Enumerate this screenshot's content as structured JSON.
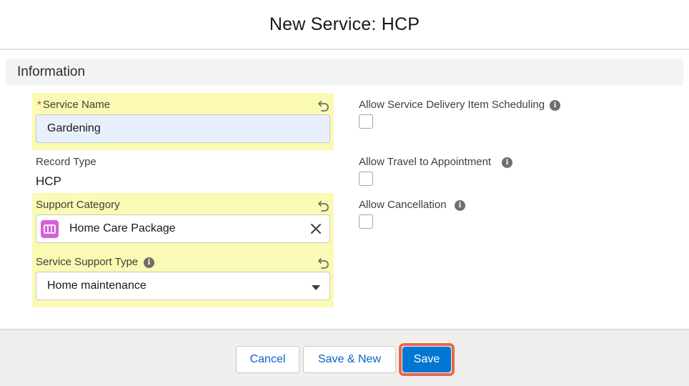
{
  "modal": {
    "title": "New Service: HCP"
  },
  "section": {
    "title": "Information"
  },
  "fields": {
    "service_name": {
      "label": "Service Name",
      "required_marker": "*",
      "value": "Gardening"
    },
    "record_type": {
      "label": "Record Type",
      "value": "HCP"
    },
    "support_category": {
      "label": "Support Category",
      "value": "Home Care Package",
      "icon": "book-icon",
      "icon_color": "#d560d9"
    },
    "service_support_type": {
      "label": "Service Support Type",
      "value": "Home maintenance"
    },
    "allow_sdi_scheduling": {
      "label": "Allow Service Delivery Item Scheduling",
      "checked": false
    },
    "allow_travel": {
      "label": "Allow Travel to Appointment",
      "checked": false
    },
    "allow_cancellation": {
      "label": "Allow Cancellation",
      "checked": false
    }
  },
  "footer": {
    "cancel_label": "Cancel",
    "save_new_label": "Save & New",
    "save_label": "Save"
  },
  "colors": {
    "highlight": "#fafab4",
    "brand": "#0176d3",
    "focus_ring": "#e8684a",
    "required": "#c23934"
  }
}
